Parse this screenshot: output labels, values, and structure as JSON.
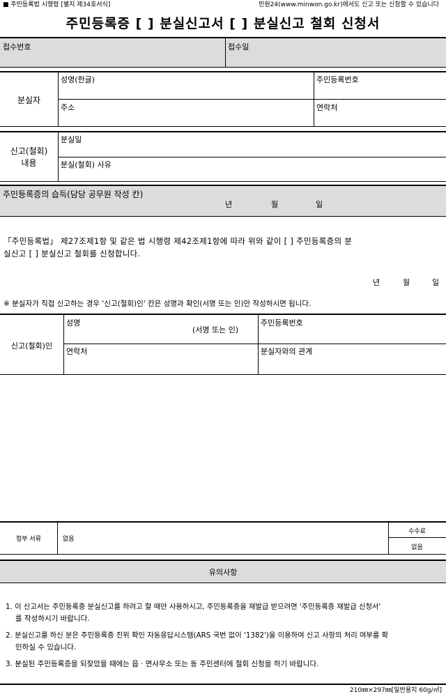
{
  "header": {
    "form_ref": "■ 주민등록법 시행령 [별지 제34호서식]",
    "online_note": "민원24(www.minwon.go.kr)에서도 신고 또는 신청할 수 있습니다"
  },
  "title": "주민등록증 [  ] 분실신고서  [  ] 분실신고 철회 신청서",
  "receipt": {
    "number_label": "접수번호",
    "date_label": "접수일"
  },
  "loser": {
    "section_label": "분실자",
    "name_label": "성명(한글)",
    "id_label": "주민등록번호",
    "address_label": "주소",
    "contact_label": "연락처"
  },
  "report": {
    "section_label_1": "신고(철회)",
    "section_label_2": "내용",
    "loss_date_label": "분실일",
    "reason_label": "분실(철회) 사유"
  },
  "found": {
    "label": "주민등록증의 습득(담당 공무원 작성 칸)",
    "year": "년",
    "month": "월",
    "day": "일"
  },
  "statement": {
    "line1": "「주민등록법」 제27조제1항 및 같은 법 시행령 제42조제1항에 따라 위와 같이 [  ] 주민등록증의 분",
    "line2": "실신고 [  ] 분실신고 철회를 신청합니다.",
    "year": "년",
    "month": "월",
    "day": "일"
  },
  "notice": "※ 분실자가 직접 신고하는 경우 '신고(철회)인' 칸은 성명과 확인(서명 또는 인)만 작성하시면 됩니다.",
  "applicant": {
    "section_label": "신고(철회)인",
    "name_label": "성명",
    "sign_label": "(서명 또는 인)",
    "id_label": "주민등록번호",
    "contact_label": "연락처",
    "relation_label": "분실자와의 관계"
  },
  "attachments": {
    "label": "첨부 서류",
    "value": "없음",
    "fee_label": "수수료",
    "fee_value": "없음"
  },
  "notes": {
    "title": "유의사항",
    "item1_line1": "1. 이 신고서는 주민등록증 분실신고를 하려고 할 때만 사용하시고, 주민등록증을 재발급 받으려면 '주민등록증 재발급 신청서'",
    "item1_line2": "를 작성하시기 바랍니다.",
    "item2_line1": "2. 분실신고를 하신 분은 주민등록증 진위 확인 자동응답시스템(ARS 국번 없이 '1382')을 이용하여 신고 사항의 처리 여부를 확",
    "item2_line2": "인하실 수 있습니다.",
    "item3": "3. 분실된 주민등록증을 되찾았을 때에는 읍ㆍ면사무소 또는 동 주민센터에 철회 신청을 하기 바랍니다."
  },
  "footer": {
    "paper_spec": "210㎜×297㎜[일반용지 60g/㎡]"
  }
}
